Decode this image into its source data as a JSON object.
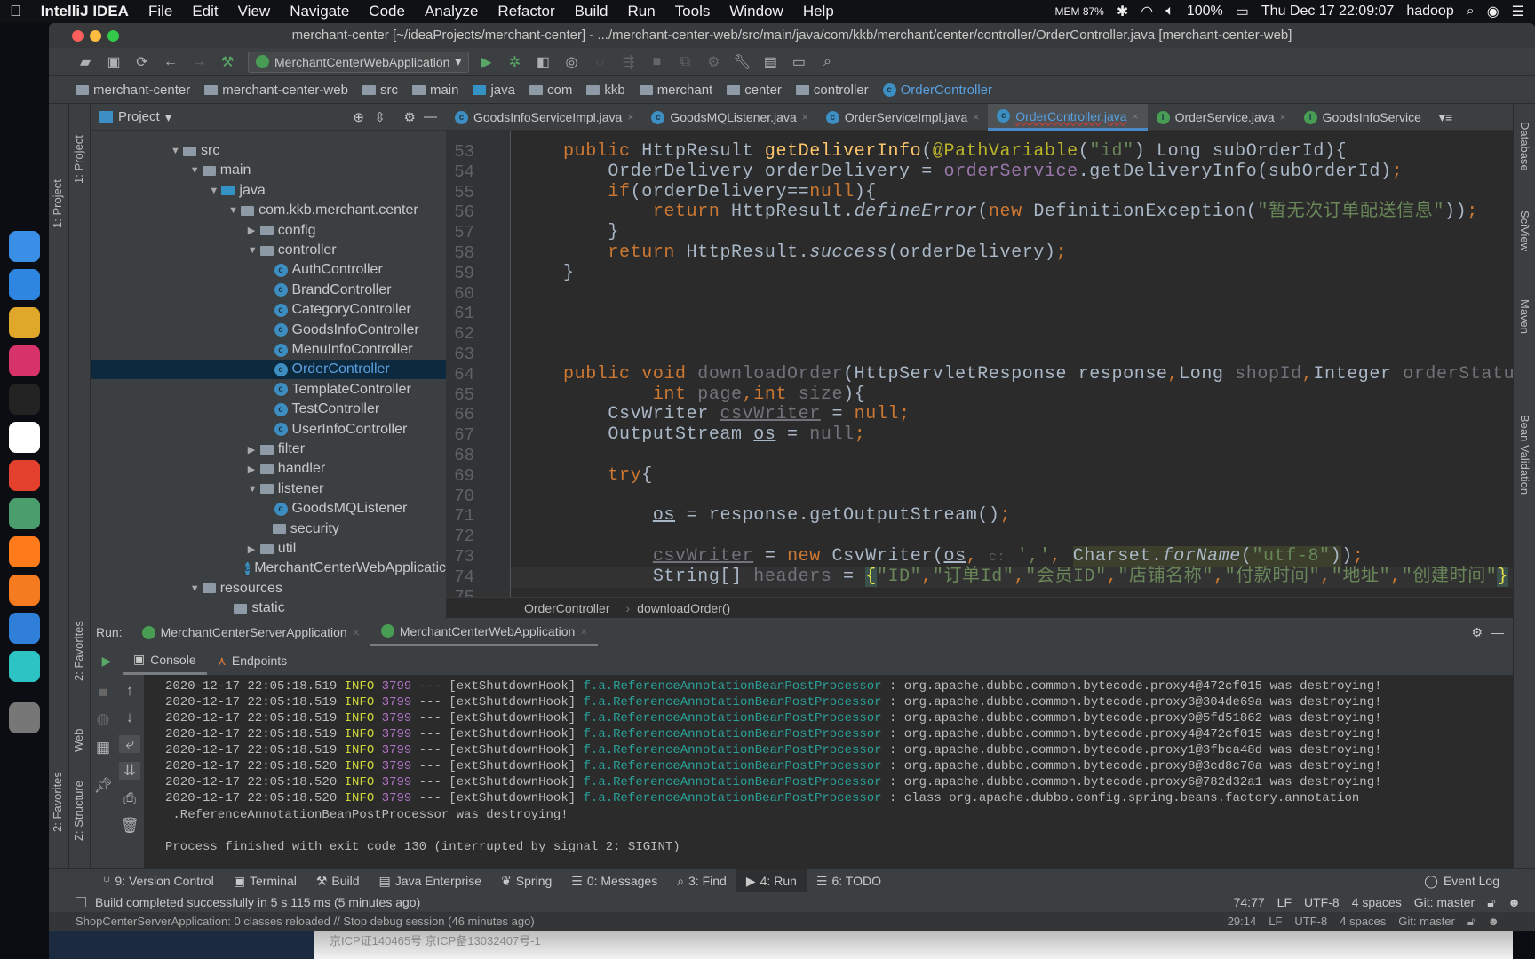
{
  "menubar": {
    "app": "IntelliJ IDEA",
    "items": [
      "File",
      "Edit",
      "View",
      "Navigate",
      "Code",
      "Analyze",
      "Refactor",
      "Build",
      "Run",
      "Tools",
      "Window",
      "Help"
    ],
    "mem": "MEM 87%",
    "battery": "100%",
    "datetime": "Thu Dec 17  22:09:07",
    "user": "hadoop"
  },
  "dock": {
    "icons": [
      "finder",
      "safari",
      "chrome",
      "intellij",
      "terminal",
      "typora",
      "xmind",
      "atom",
      "firefox",
      "sublime",
      "eclipse",
      "sourcetree",
      "trash"
    ],
    "colors": [
      "#3a8ee6",
      "#2f86e0",
      "#e0a82a",
      "#d8326a",
      "#222",
      "#ffffff",
      "#e4402e",
      "#4a9e6e",
      "#ff7a1a",
      "#f57b20",
      "#2f7fd8",
      "#2ec3c3",
      "#777"
    ]
  },
  "window": {
    "title": "merchant-center [~/ideaProjects/merchant-center] - .../merchant-center-web/src/main/java/com/kkb/merchant/center/controller/OrderController.java [merchant-center-web]"
  },
  "toolbar": {
    "run_config": "MerchantCenterWebApplication"
  },
  "navbar": [
    {
      "label": "merchant-center",
      "icon": "module"
    },
    {
      "label": "merchant-center-web",
      "icon": "module"
    },
    {
      "label": "src",
      "icon": "folder"
    },
    {
      "label": "main",
      "icon": "folder"
    },
    {
      "label": "java",
      "icon": "folder-blue"
    },
    {
      "label": "com",
      "icon": "folder"
    },
    {
      "label": "kkb",
      "icon": "folder"
    },
    {
      "label": "merchant",
      "icon": "folder"
    },
    {
      "label": "center",
      "icon": "folder"
    },
    {
      "label": "controller",
      "icon": "folder"
    },
    {
      "label": "OrderController",
      "icon": "class"
    }
  ],
  "left_stripe": {
    "project": "1: Project",
    "favorites": "2: Favorites",
    "structure": "Z: Structure",
    "web": "Web"
  },
  "right_stripe": [
    "Database",
    "SciView",
    "Maven",
    "Bean Validation"
  ],
  "project": {
    "title": "Project",
    "tree": [
      {
        "label": "src",
        "level": 0,
        "type": "folder",
        "state": "open"
      },
      {
        "label": "main",
        "level": 1,
        "type": "folder",
        "state": "open"
      },
      {
        "label": "java",
        "level": 2,
        "type": "folder-blue",
        "state": "open"
      },
      {
        "label": "com.kkb.merchant.center",
        "level": 3,
        "type": "package",
        "state": "open"
      },
      {
        "label": "config",
        "level": 4,
        "type": "package",
        "state": "closed"
      },
      {
        "label": "controller",
        "level": 4,
        "type": "package",
        "state": "open"
      },
      {
        "label": "AuthController",
        "level": 5,
        "type": "class"
      },
      {
        "label": "BrandController",
        "level": 5,
        "type": "class"
      },
      {
        "label": "CategoryController",
        "level": 5,
        "type": "class"
      },
      {
        "label": "GoodsInfoController",
        "level": 5,
        "type": "class"
      },
      {
        "label": "MenuInfoController",
        "level": 5,
        "type": "class"
      },
      {
        "label": "OrderController",
        "level": 5,
        "type": "class",
        "selected": true
      },
      {
        "label": "TemplateController",
        "level": 5,
        "type": "class"
      },
      {
        "label": "TestController",
        "level": 5,
        "type": "class"
      },
      {
        "label": "UserInfoController",
        "level": 5,
        "type": "class"
      },
      {
        "label": "filter",
        "level": 4,
        "type": "package",
        "state": "closed"
      },
      {
        "label": "handler",
        "level": 4,
        "type": "package",
        "state": "closed"
      },
      {
        "label": "listener",
        "level": 4,
        "type": "package",
        "state": "open"
      },
      {
        "label": "GoodsMQListener",
        "level": 5,
        "type": "class"
      },
      {
        "label": "security",
        "level": 4,
        "type": "package"
      },
      {
        "label": "util",
        "level": 4,
        "type": "package",
        "state": "closed"
      },
      {
        "label": "MerchantCenterWebApplicatic",
        "level": 4,
        "type": "app-class"
      },
      {
        "label": "resources",
        "level": 1,
        "type": "folder",
        "state": "open"
      },
      {
        "label": "static",
        "level": 2,
        "type": "package"
      }
    ]
  },
  "editor_tabs": [
    {
      "label": "GoodsInfoServiceImpl.java",
      "icon": "class"
    },
    {
      "label": "GoodsMQListener.java",
      "icon": "class"
    },
    {
      "label": "OrderServiceImpl.java",
      "icon": "class"
    },
    {
      "label": "OrderController.java",
      "icon": "class",
      "active": true
    },
    {
      "label": "OrderService.java",
      "icon": "interface"
    },
    {
      "label": "GoodsInfoService",
      "icon": "interface"
    }
  ],
  "editor": {
    "first_line": 53,
    "current_line": 74,
    "lines": [
      [
        [
          "k",
          "public"
        ],
        [
          "d",
          " HttpResult "
        ],
        [
          "m",
          "getDeliverInfo"
        ],
        [
          "d",
          "("
        ],
        [
          "a",
          "@PathVariable"
        ],
        [
          "d",
          "("
        ],
        [
          "s",
          "\"id\""
        ],
        [
          "d",
          ") Long subOrderId){"
        ]
      ],
      [
        [
          "d",
          "    OrderDelivery orderDelivery = "
        ],
        [
          "f",
          "orderService"
        ],
        [
          "d",
          ".getDeliveryInfo(subOrderId)"
        ],
        [
          "k",
          ";"
        ]
      ],
      [
        [
          "d",
          "    "
        ],
        [
          "k",
          "if"
        ],
        [
          "d",
          "(orderDelivery=="
        ],
        [
          "k",
          "null"
        ],
        [
          "d",
          "){"
        ]
      ],
      [
        [
          "d",
          "        "
        ],
        [
          "k",
          "return"
        ],
        [
          "d",
          " HttpResult."
        ],
        [
          "d i",
          "defineError"
        ],
        [
          "d",
          "("
        ],
        [
          "k",
          "new"
        ],
        [
          "d",
          " DefinitionException("
        ],
        [
          "s",
          "\"暂无次订单配送信息\""
        ],
        [
          "d",
          "))"
        ],
        [
          "k",
          ";"
        ]
      ],
      [
        [
          "d",
          "    }"
        ]
      ],
      [
        [
          "d",
          "    "
        ],
        [
          "k",
          "return"
        ],
        [
          "d",
          " HttpResult."
        ],
        [
          "d i",
          "success"
        ],
        [
          "d",
          "(orderDelivery)"
        ],
        [
          "k",
          ";"
        ]
      ],
      [
        [
          "d",
          "}"
        ]
      ],
      [],
      [],
      [],
      [],
      [
        [
          "k",
          "public void"
        ],
        [
          "d",
          " "
        ],
        [
          "g",
          "downloadOrder"
        ],
        [
          "d",
          "(HttpServletResponse response"
        ],
        [
          "k",
          ","
        ],
        [
          "d",
          "Long "
        ],
        [
          "g",
          "shopId"
        ],
        [
          "k",
          ","
        ],
        [
          "d",
          "Integer "
        ],
        [
          "g",
          "orderStatus"
        ],
        [
          "k",
          ","
        ]
      ],
      [
        [
          "d",
          "        "
        ],
        [
          "k",
          "int"
        ],
        [
          "d",
          " "
        ],
        [
          "g",
          "page"
        ],
        [
          "k",
          ","
        ],
        [
          "k",
          "int"
        ],
        [
          "d",
          " "
        ],
        [
          "g",
          "size"
        ],
        [
          "d",
          "){"
        ]
      ],
      [
        [
          "d",
          "    CsvWriter "
        ],
        [
          "gu",
          "csvWriter"
        ],
        [
          "d",
          " = "
        ],
        [
          "k",
          "null;"
        ]
      ],
      [
        [
          "d",
          "    OutputStream "
        ],
        [
          "u",
          "os"
        ],
        [
          "d",
          " = "
        ],
        [
          "g",
          "null"
        ],
        [
          "k",
          ";"
        ]
      ],
      [],
      [
        [
          "d",
          "    "
        ],
        [
          "k",
          "try"
        ],
        [
          "d",
          "{"
        ]
      ],
      [],
      [
        [
          "d",
          "        "
        ],
        [
          "u",
          "os"
        ],
        [
          "d",
          " = response.getOutputStream()"
        ],
        [
          "k",
          ";"
        ]
      ],
      [],
      [
        [
          "d",
          "        "
        ],
        [
          "gu",
          "csvWriter"
        ],
        [
          "d",
          " = "
        ],
        [
          "k",
          "new"
        ],
        [
          "d",
          " CsvWriter("
        ],
        [
          "u",
          "os"
        ],
        [
          "k",
          ", "
        ],
        [
          "h",
          "c:"
        ],
        [
          "d",
          " "
        ],
        [
          "s",
          "','"
        ],
        [
          "k",
          ", "
        ],
        [
          "d hl",
          "Charset."
        ],
        [
          "d hl i",
          "forName"
        ],
        [
          "d hl",
          "("
        ],
        [
          "s hl",
          "\"utf-8\""
        ],
        [
          "d hl",
          ")"
        ],
        [
          "d",
          ")"
        ],
        [
          "k",
          ";"
        ]
      ],
      [
        [
          "d",
          "        String[] "
        ],
        [
          "g",
          "headers"
        ],
        [
          "d",
          " = "
        ],
        [
          "y",
          "{"
        ],
        [
          "s",
          "\"ID\""
        ],
        [
          "k",
          ","
        ],
        [
          "s",
          "\"订单Id\""
        ],
        [
          "k",
          ","
        ],
        [
          "s",
          "\"会员ID\""
        ],
        [
          "k",
          ","
        ],
        [
          "s",
          "\"店铺名称\""
        ],
        [
          "k",
          ","
        ],
        [
          "s",
          "\"付款时间\""
        ],
        [
          "k",
          ","
        ],
        [
          "s",
          "\"地址\""
        ],
        [
          "k",
          ","
        ],
        [
          "s",
          "\"创建时间\""
        ],
        [
          "y",
          "}"
        ]
      ],
      []
    ]
  },
  "editor_breadcrumb": [
    "OrderController",
    "downloadOrder()"
  ],
  "run": {
    "label": "Run:",
    "tabs": [
      {
        "label": "MerchantCenterServerApplication"
      },
      {
        "label": "MerchantCenterWebApplication",
        "active": true
      }
    ],
    "console_tab": "Console",
    "endpoints_tab": "Endpoints",
    "log": [
      {
        "ts": "2020-12-17 22:05:18.519",
        "level": "INFO",
        "pid": "3799",
        "sep": "---",
        "thread": "[extShutdownHook]",
        "logger": "f.a.ReferenceAnnotationBeanPostProcessor",
        "msg": ": org.apache.dubbo.common.bytecode.proxy4@472cf015 was destroying!"
      },
      {
        "ts": "2020-12-17 22:05:18.519",
        "level": "INFO",
        "pid": "3799",
        "sep": "---",
        "thread": "[extShutdownHook]",
        "logger": "f.a.ReferenceAnnotationBeanPostProcessor",
        "msg": ": org.apache.dubbo.common.bytecode.proxy3@304de69a was destroying!"
      },
      {
        "ts": "2020-12-17 22:05:18.519",
        "level": "INFO",
        "pid": "3799",
        "sep": "---",
        "thread": "[extShutdownHook]",
        "logger": "f.a.ReferenceAnnotationBeanPostProcessor",
        "msg": ": org.apache.dubbo.common.bytecode.proxy0@5fd51862 was destroying!"
      },
      {
        "ts": "2020-12-17 22:05:18.519",
        "level": "INFO",
        "pid": "3799",
        "sep": "---",
        "thread": "[extShutdownHook]",
        "logger": "f.a.ReferenceAnnotationBeanPostProcessor",
        "msg": ": org.apache.dubbo.common.bytecode.proxy4@472cf015 was destroying!"
      },
      {
        "ts": "2020-12-17 22:05:18.519",
        "level": "INFO",
        "pid": "3799",
        "sep": "---",
        "thread": "[extShutdownHook]",
        "logger": "f.a.ReferenceAnnotationBeanPostProcessor",
        "msg": ": org.apache.dubbo.common.bytecode.proxy1@3fbca48d was destroying!"
      },
      {
        "ts": "2020-12-17 22:05:18.520",
        "level": "INFO",
        "pid": "3799",
        "sep": "---",
        "thread": "[extShutdownHook]",
        "logger": "f.a.ReferenceAnnotationBeanPostProcessor",
        "msg": ": org.apache.dubbo.common.bytecode.proxy8@3cd8c70a was destroying!"
      },
      {
        "ts": "2020-12-17 22:05:18.520",
        "level": "INFO",
        "pid": "3799",
        "sep": "---",
        "thread": "[extShutdownHook]",
        "logger": "f.a.ReferenceAnnotationBeanPostProcessor",
        "msg": ": org.apache.dubbo.common.bytecode.proxy6@782d32a1 was destroying!"
      },
      {
        "ts": "2020-12-17 22:05:18.520",
        "level": "INFO",
        "pid": "3799",
        "sep": "---",
        "thread": "[extShutdownHook]",
        "logger": "f.a.ReferenceAnnotationBeanPostProcessor",
        "msg": ": class org.apache.dubbo.config.spring.beans.factory.annotation"
      }
    ],
    "continuation": " .ReferenceAnnotationBeanPostProcessor was destroying!",
    "exit": "Process finished with exit code 130 (interrupted by signal 2: SIGINT)"
  },
  "tool_windows": [
    {
      "label": "9: Version Control",
      "icon": "vcs"
    },
    {
      "label": "Terminal",
      "icon": "terminal"
    },
    {
      "label": "Build",
      "icon": "hammer"
    },
    {
      "label": "Java Enterprise",
      "icon": "javaee"
    },
    {
      "label": "Spring",
      "icon": "spring-leaf"
    },
    {
      "label": "0: Messages",
      "icon": "messages"
    },
    {
      "label": "3: Find",
      "icon": "search"
    },
    {
      "label": "4: Run",
      "icon": "play",
      "active": true
    },
    {
      "label": "6: TODO",
      "icon": "list"
    }
  ],
  "event_log": "Event Log",
  "status": {
    "message": "Build completed successfully in 5 s 115 ms (5 minutes ago)",
    "position": "74:77",
    "line_sep": "LF",
    "encoding": "UTF-8",
    "indent": "4 spaces",
    "vcs": "Git: master"
  },
  "status2": {
    "message": "ShopCenterServerApplication: 0 classes reloaded // Stop debug session (46 minutes ago)",
    "position": "29:14",
    "line_sep": "LF",
    "encoding": "UTF-8",
    "indent": "4 spaces",
    "vcs": "Git: master"
  },
  "footer": {
    "text": "京ICP证140465号 京ICP备13032407号-1"
  }
}
